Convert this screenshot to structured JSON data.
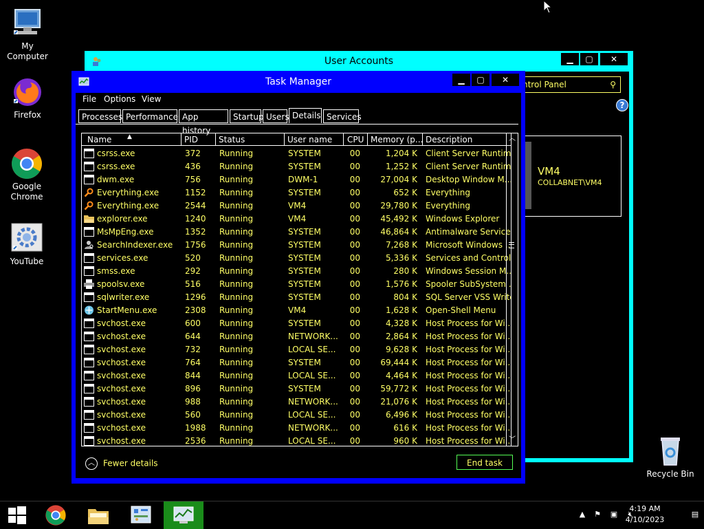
{
  "desktop_icons": [
    {
      "label": "My Computer"
    },
    {
      "label": "Firefox"
    },
    {
      "label": "Google Chrome"
    },
    {
      "label": "YouTube"
    },
    {
      "label": "Recycle Bin"
    }
  ],
  "user_accounts": {
    "title": "User Accounts",
    "search_text": "ntrol Panel",
    "help_label": "?",
    "user_name": "VM4",
    "user_domain": "COLLABNET\\VM4"
  },
  "task_manager": {
    "title": "Task Manager",
    "menu": [
      "File",
      "Options",
      "View"
    ],
    "tabs": [
      "Processes",
      "Performance",
      "App history",
      "Startup",
      "Users",
      "Details",
      "Services"
    ],
    "active_tab": "Details",
    "columns": [
      "Name",
      "PID",
      "Status",
      "User name",
      "CPU",
      "Memory (p...",
      "Description"
    ],
    "rows": [
      {
        "icon": "window-icon",
        "name": "csrss.exe",
        "pid": "372",
        "status": "Running",
        "user": "SYSTEM",
        "cpu": "00",
        "mem": "1,204 K",
        "desc": "Client Server Runtim..."
      },
      {
        "icon": "window-icon",
        "name": "csrss.exe",
        "pid": "436",
        "status": "Running",
        "user": "SYSTEM",
        "cpu": "00",
        "mem": "1,252 K",
        "desc": "Client Server Runtim..."
      },
      {
        "icon": "window-icon",
        "name": "dwm.exe",
        "pid": "756",
        "status": "Running",
        "user": "DWM-1",
        "cpu": "00",
        "mem": "27,004 K",
        "desc": "Desktop Window M..."
      },
      {
        "icon": "magnifier-icon",
        "name": "Everything.exe",
        "pid": "1152",
        "status": "Running",
        "user": "SYSTEM",
        "cpu": "00",
        "mem": "652 K",
        "desc": "Everything"
      },
      {
        "icon": "magnifier-icon",
        "name": "Everything.exe",
        "pid": "2544",
        "status": "Running",
        "user": "VM4",
        "cpu": "00",
        "mem": "29,780 K",
        "desc": "Everything"
      },
      {
        "icon": "folder-icon",
        "name": "explorer.exe",
        "pid": "1240",
        "status": "Running",
        "user": "VM4",
        "cpu": "00",
        "mem": "45,492 K",
        "desc": "Windows Explorer"
      },
      {
        "icon": "window-icon",
        "name": "MsMpEng.exe",
        "pid": "1352",
        "status": "Running",
        "user": "SYSTEM",
        "cpu": "00",
        "mem": "46,864 K",
        "desc": "Antimalware Service..."
      },
      {
        "icon": "user-search-icon",
        "name": "SearchIndexer.exe",
        "pid": "1756",
        "status": "Running",
        "user": "SYSTEM",
        "cpu": "00",
        "mem": "7,268 K",
        "desc": "Microsoft Windows ..."
      },
      {
        "icon": "window-icon",
        "name": "services.exe",
        "pid": "520",
        "status": "Running",
        "user": "SYSTEM",
        "cpu": "00",
        "mem": "5,336 K",
        "desc": "Services and Control..."
      },
      {
        "icon": "window-icon",
        "name": "smss.exe",
        "pid": "292",
        "status": "Running",
        "user": "SYSTEM",
        "cpu": "00",
        "mem": "280 K",
        "desc": "Windows Session M..."
      },
      {
        "icon": "printer-icon",
        "name": "spoolsv.exe",
        "pid": "516",
        "status": "Running",
        "user": "SYSTEM",
        "cpu": "00",
        "mem": "1,576 K",
        "desc": "Spooler SubSystem ..."
      },
      {
        "icon": "window-icon",
        "name": "sqlwriter.exe",
        "pid": "1296",
        "status": "Running",
        "user": "SYSTEM",
        "cpu": "00",
        "mem": "804 K",
        "desc": "SQL Server VSS Write..."
      },
      {
        "icon": "shell-icon",
        "name": "StartMenu.exe",
        "pid": "2308",
        "status": "Running",
        "user": "VM4",
        "cpu": "00",
        "mem": "1,628 K",
        "desc": "Open-Shell Menu"
      },
      {
        "icon": "window-icon",
        "name": "svchost.exe",
        "pid": "600",
        "status": "Running",
        "user": "SYSTEM",
        "cpu": "00",
        "mem": "4,328 K",
        "desc": "Host Process for Wi..."
      },
      {
        "icon": "window-icon",
        "name": "svchost.exe",
        "pid": "644",
        "status": "Running",
        "user": "NETWORK...",
        "cpu": "00",
        "mem": "2,864 K",
        "desc": "Host Process for Wi..."
      },
      {
        "icon": "window-icon",
        "name": "svchost.exe",
        "pid": "732",
        "status": "Running",
        "user": "LOCAL SE...",
        "cpu": "00",
        "mem": "9,628 K",
        "desc": "Host Process for Wi..."
      },
      {
        "icon": "window-icon",
        "name": "svchost.exe",
        "pid": "764",
        "status": "Running",
        "user": "SYSTEM",
        "cpu": "00",
        "mem": "69,444 K",
        "desc": "Host Process for Wi..."
      },
      {
        "icon": "window-icon",
        "name": "svchost.exe",
        "pid": "844",
        "status": "Running",
        "user": "LOCAL SE...",
        "cpu": "00",
        "mem": "4,464 K",
        "desc": "Host Process for Wi..."
      },
      {
        "icon": "window-icon",
        "name": "svchost.exe",
        "pid": "896",
        "status": "Running",
        "user": "SYSTEM",
        "cpu": "00",
        "mem": "59,772 K",
        "desc": "Host Process for Wi..."
      },
      {
        "icon": "window-icon",
        "name": "svchost.exe",
        "pid": "988",
        "status": "Running",
        "user": "NETWORK...",
        "cpu": "00",
        "mem": "21,076 K",
        "desc": "Host Process for Wi..."
      },
      {
        "icon": "window-icon",
        "name": "svchost.exe",
        "pid": "560",
        "status": "Running",
        "user": "LOCAL SE...",
        "cpu": "00",
        "mem": "6,496 K",
        "desc": "Host Process for Wi..."
      },
      {
        "icon": "window-icon",
        "name": "svchost.exe",
        "pid": "1988",
        "status": "Running",
        "user": "NETWORK...",
        "cpu": "00",
        "mem": "616 K",
        "desc": "Host Process for Wi..."
      },
      {
        "icon": "window-icon",
        "name": "svchost.exe",
        "pid": "2536",
        "status": "Running",
        "user": "LOCAL SE...",
        "cpu": "00",
        "mem": "960 K",
        "desc": "Host Process for Wi..."
      }
    ],
    "fewer_details": "Fewer details",
    "end_task": "End task"
  },
  "taskbar": {
    "time": "4:19 AM",
    "date": "4/10/2023"
  },
  "colors": {
    "task_manager_frame": "#0000ff",
    "user_accounts_frame": "#00ffff",
    "text_yellow": "#ffff66",
    "end_task_border": "#55ff55"
  }
}
